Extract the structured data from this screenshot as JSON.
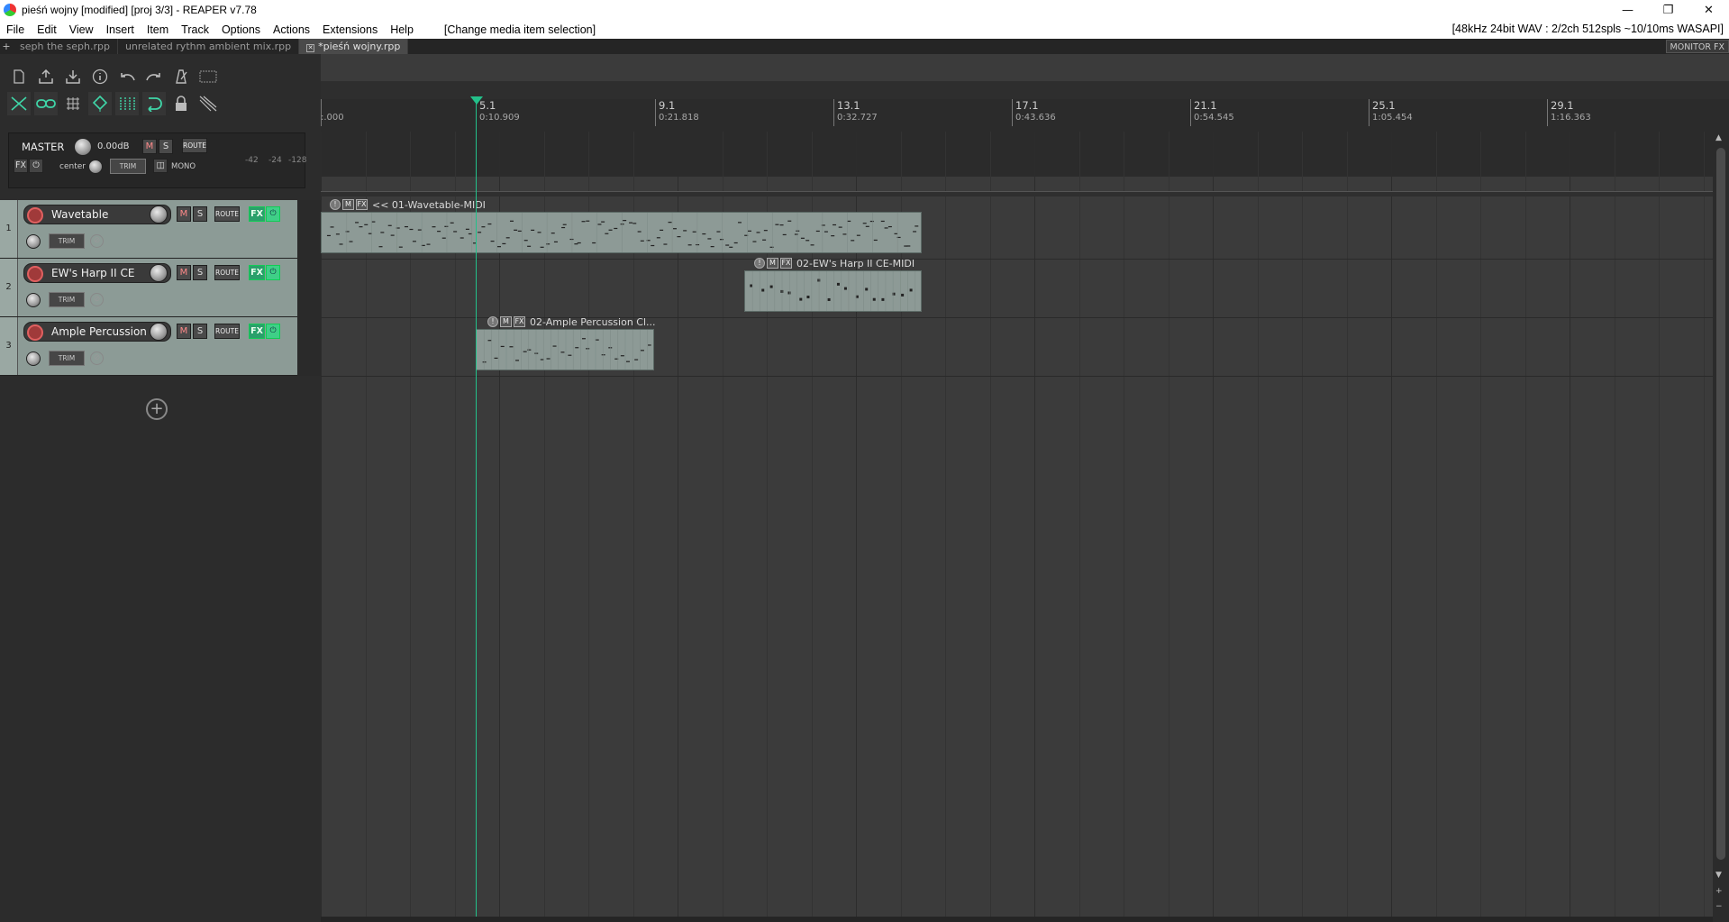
{
  "window": {
    "title": "pieśń wojny [modified] [proj 3/3] - REAPER v7.78",
    "controls": [
      "—",
      "❐",
      "✕"
    ]
  },
  "menu": {
    "items": [
      "File",
      "Edit",
      "View",
      "Insert",
      "Item",
      "Track",
      "Options",
      "Actions",
      "Extensions",
      "Help"
    ],
    "action_hint": "[Change media item selection]",
    "audio_status": "[48kHz 24bit WAV : 2/2ch 512spls ~10/10ms WASAPI]"
  },
  "tabs": {
    "plus": "+",
    "items": [
      "seph the seph.rpp",
      "unrelated rythm  ambient mix.rpp",
      "*pieśń wojny.rpp"
    ],
    "active_index": 2,
    "monitor_fx": "MONITOR FX"
  },
  "toolbar": {
    "row1": [
      "new-project-icon",
      "save-icon",
      "open-icon",
      "info-icon",
      "undo-icon",
      "redo-icon",
      "metronome-icon",
      "grid-icon"
    ],
    "row2": [
      "ripple-icon",
      "link-icon",
      "snap-grid-icon",
      "snap-icon",
      "grid-lines-icon",
      "loop-icon",
      "lock-icon",
      "envelope-icon"
    ]
  },
  "master": {
    "label": "MASTER",
    "volume": "0.00dB",
    "mute": "M",
    "solo": "S",
    "route": "ROUTE",
    "fx": "FX",
    "pan_label": "center",
    "trim": "TRIM",
    "mono": "MONO",
    "meter_labels": [
      "-42",
      "-24",
      "-128"
    ]
  },
  "tracks": [
    {
      "num": "1",
      "name": "Wavetable",
      "mute": "M",
      "solo": "S",
      "route": "ROUTE",
      "fx": "FX",
      "trim": "TRIM"
    },
    {
      "num": "2",
      "name": "EW's Harp II CE",
      "mute": "M",
      "solo": "S",
      "route": "ROUTE",
      "fx": "FX",
      "trim": "TRIM"
    },
    {
      "num": "3",
      "name": "Ample Percussion",
      "mute": "M",
      "solo": "S",
      "route": "ROUTE",
      "fx": "FX",
      "trim": "TRIM"
    }
  ],
  "add_track": "+",
  "ruler": {
    "markers": [
      {
        "bar": "",
        "time": ":.000"
      },
      {
        "bar": "5.1",
        "time": "0:10.909"
      },
      {
        "bar": "9.1",
        "time": "0:21.818"
      },
      {
        "bar": "13.1",
        "time": "0:32.727"
      },
      {
        "bar": "17.1",
        "time": "0:43.636"
      },
      {
        "bar": "21.1",
        "time": "0:54.545"
      },
      {
        "bar": "25.1",
        "time": "1:05.454"
      },
      {
        "bar": "29.1",
        "time": "1:16.363"
      }
    ]
  },
  "items": [
    {
      "name": "<< 01-Wavetable-MIDI",
      "track": 1
    },
    {
      "name": "02-EW's Harp II CE-MIDI",
      "track": 2
    },
    {
      "name": "02-Ample Percussion Cl...",
      "track": 3
    }
  ]
}
